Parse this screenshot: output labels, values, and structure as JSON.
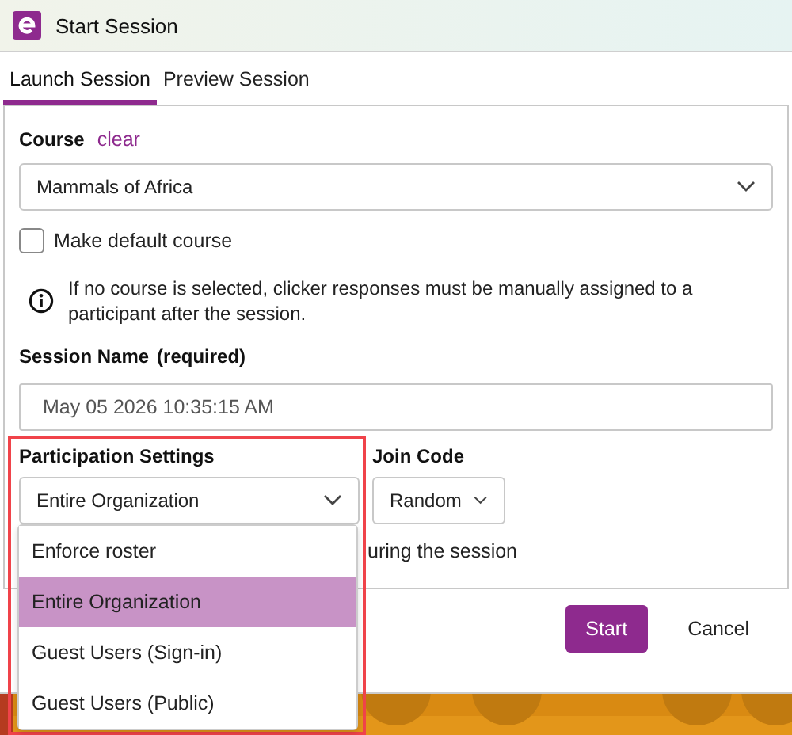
{
  "window": {
    "title": "Start Session"
  },
  "tabs": [
    {
      "label": "Launch Session",
      "selected": true
    },
    {
      "label": "Preview Session",
      "selected": false
    }
  ],
  "course": {
    "label": "Course",
    "clear_link": "clear",
    "value": "Mammals of Africa"
  },
  "default_course": {
    "label": "Make default course",
    "checked": false
  },
  "info": "If no course is selected, clicker responses must be manually assigned to a participant after the session.",
  "session_name": {
    "label": "Session Name",
    "hint": "(required)",
    "value": "May 05 2026 10:35:15 AM"
  },
  "participation": {
    "label": "Participation Settings",
    "value": "Entire Organization",
    "expanded": true,
    "highlighted": true,
    "options": [
      {
        "label": "Enforce roster",
        "selected": false
      },
      {
        "label": "Entire Organization",
        "selected": true
      },
      {
        "label": "Guest Users (Sign-in)",
        "selected": false
      },
      {
        "label": "Guest Users (Public)",
        "selected": false
      }
    ]
  },
  "join_code": {
    "label": "Join Code",
    "value": "Random"
  },
  "covered_option": "uring the session",
  "buttons": [
    {
      "label": "Start",
      "kind": "primary"
    },
    {
      "label": "Cancel",
      "kind": "secondary"
    }
  ]
}
